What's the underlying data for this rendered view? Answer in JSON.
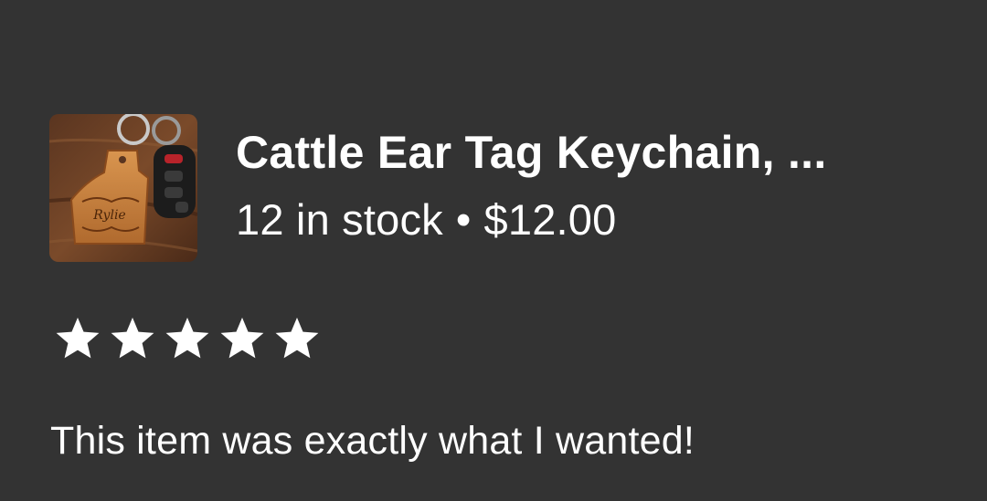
{
  "product": {
    "title": "Cattle Ear Tag Keychain, ...",
    "stock": "12 in stock",
    "separator": "•",
    "price": "$12.00",
    "thumbnail_engraving": "Rylie"
  },
  "review": {
    "rating": 5,
    "max_rating": 5,
    "text": "This item was exactly what I wanted!"
  },
  "colors": {
    "background": "#333333",
    "text": "#ffffff",
    "star": "#ffffff"
  },
  "icons": {
    "star": "star-icon"
  }
}
